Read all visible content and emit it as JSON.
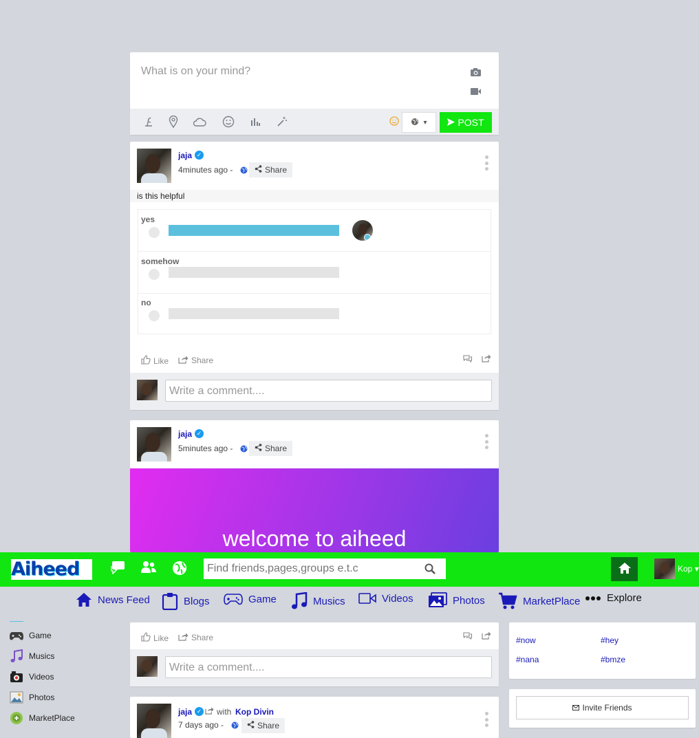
{
  "composer": {
    "placeholder": "What is on your mind?",
    "post_label": "POST"
  },
  "posts": [
    {
      "user": "jaja",
      "time": "4minutes ago -",
      "share_label": "Share",
      "text": "is this helpful",
      "poll": [
        {
          "label": "yes",
          "fraction": 1.0
        },
        {
          "label": "somehow",
          "fraction": 0.0
        },
        {
          "label": "no",
          "fraction": 0.0
        }
      ],
      "like_label": "Like",
      "share_action_label": "Share",
      "comment_placeholder": "Write a comment...."
    },
    {
      "user": "jaja",
      "time": "5minutes ago -",
      "share_label": "Share",
      "banner_text": "welcome to aiheed",
      "banner_colors": [
        "#e22cf0",
        "#6a3fe0"
      ]
    },
    {
      "like_label": "Like",
      "share_action_label": "Share",
      "comment_placeholder": "Write a comment...."
    },
    {
      "user": "jaja",
      "with_label": "with",
      "with_user": "Kop Divin",
      "time": "7 days ago -",
      "share_label": "Share"
    }
  ],
  "topbar": {
    "logo_text": "Aiheed",
    "search_placeholder": "Find friends,pages,groups e.t.c",
    "profile_name": "Kop",
    "brand_color": "#11e611"
  },
  "subnav": [
    {
      "label": "News Feed",
      "icon": "home-icon"
    },
    {
      "label": "Blogs",
      "icon": "clipboard-icon"
    },
    {
      "label": "Game",
      "icon": "gamepad-icon"
    },
    {
      "label": "Musics",
      "icon": "music-icon"
    },
    {
      "label": "Videos",
      "icon": "video-icon"
    },
    {
      "label": "Photos",
      "icon": "photos-icon"
    },
    {
      "label": "MarketPlace",
      "icon": "cart-icon"
    },
    {
      "label": "Explore",
      "icon": "dots-icon"
    }
  ],
  "sidebar": [
    {
      "label": "Game"
    },
    {
      "label": "Musics"
    },
    {
      "label": "Videos"
    },
    {
      "label": "Photos"
    },
    {
      "label": "MarketPlace"
    }
  ],
  "hashtags": [
    "#now",
    "#hey",
    "#nana",
    "#bmze"
  ],
  "invite_label": "Invite Friends"
}
